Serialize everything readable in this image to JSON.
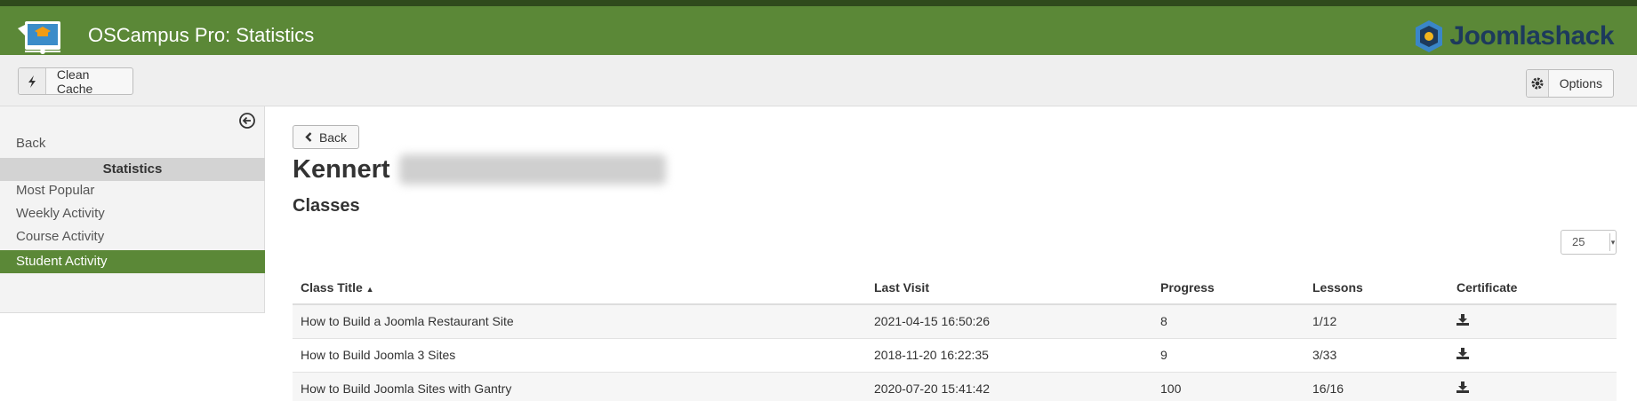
{
  "header": {
    "title": "OSCampus Pro: Statistics",
    "brand": "Joomlashack",
    "logo_icon": "graduation-cap-icon",
    "brand_icon": "joomlashack-logo-icon",
    "color": "#5b8837"
  },
  "toolbar": {
    "clean_cache_label": "Clean Cache",
    "options_label": "Options"
  },
  "sidebar": {
    "back": "Back",
    "heading": "Statistics",
    "items": [
      "Most Popular",
      "Weekly Activity",
      "Course Activity",
      "Student Activity"
    ],
    "active": "Student Activity"
  },
  "main": {
    "back_label": "Back",
    "student_first_name": "Kennert",
    "section_title": "Classes",
    "list_limit": "25"
  },
  "table": {
    "columns": [
      "Class Title",
      "Last Visit",
      "Progress",
      "Lessons",
      "Certificate"
    ],
    "sort_indicator": "▲",
    "rows": [
      {
        "title": "How to Build a Joomla Restaurant Site",
        "last_visit": "2021-04-15 16:50:26",
        "progress": "8",
        "lessons": "1/12"
      },
      {
        "title": "How to Build Joomla 3 Sites",
        "last_visit": "2018-11-20 16:22:35",
        "progress": "9",
        "lessons": "3/33"
      },
      {
        "title": "How to Build Joomla Sites with Gantry",
        "last_visit": "2020-07-20 15:41:42",
        "progress": "100",
        "lessons": "16/16"
      }
    ]
  }
}
